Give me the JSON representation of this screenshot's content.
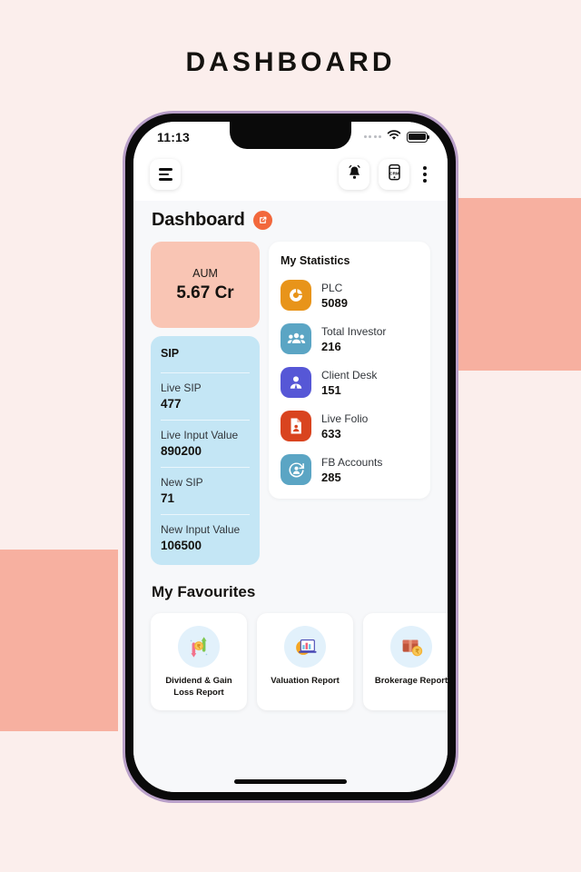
{
  "page": {
    "title": "DASHBOARD",
    "bg_color": "#fbeeec",
    "accent_color": "#f7b0a0"
  },
  "status_bar": {
    "time": "11:13"
  },
  "appbar": {
    "menu_icon": "hamburger-menu-icon",
    "notification_icon": "bell-icon",
    "crm_icon": "crm-phone-icon",
    "crm_label": "CRM",
    "more_icon": "kebab-menu-icon"
  },
  "header": {
    "title": "Dashboard",
    "badge_icon": "external-link-icon",
    "badge_color": "#f2683c"
  },
  "aum": {
    "label": "AUM",
    "value": "5.67 Cr",
    "color": "#f9c5b4"
  },
  "sip": {
    "title": "SIP",
    "color": "#c4e6f5",
    "rows": [
      {
        "label": "Live SIP",
        "value": "477"
      },
      {
        "label": "Live Input Value",
        "value": "890200"
      },
      {
        "label": "New SIP",
        "value": "71"
      },
      {
        "label": "New Input Value",
        "value": "106500"
      }
    ]
  },
  "statistics": {
    "title": "My Statistics",
    "items": [
      {
        "label": "PLC",
        "value": "5089",
        "icon": "donut-chart-icon",
        "color": "#e8941a"
      },
      {
        "label": "Total Investor",
        "value": "216",
        "icon": "people-group-icon",
        "color": "#5ba5c4"
      },
      {
        "label": "Client Desk",
        "value": "151",
        "icon": "person-badge-icon",
        "color": "#5657d6"
      },
      {
        "label": "Live Folio",
        "value": "633",
        "icon": "document-person-icon",
        "color": "#d9441f"
      },
      {
        "label": "FB Accounts",
        "value": "285",
        "icon": "refresh-person-icon",
        "color": "#5ba5c4"
      }
    ]
  },
  "favourites": {
    "title": "My Favourites",
    "items": [
      {
        "label": "Dividend & Gain Loss Report",
        "icon": "dividend-gain-loss-icon"
      },
      {
        "label": "Valuation Report",
        "icon": "valuation-chart-icon"
      },
      {
        "label": "Brokerage Report",
        "icon": "brokerage-box-icon"
      }
    ]
  }
}
